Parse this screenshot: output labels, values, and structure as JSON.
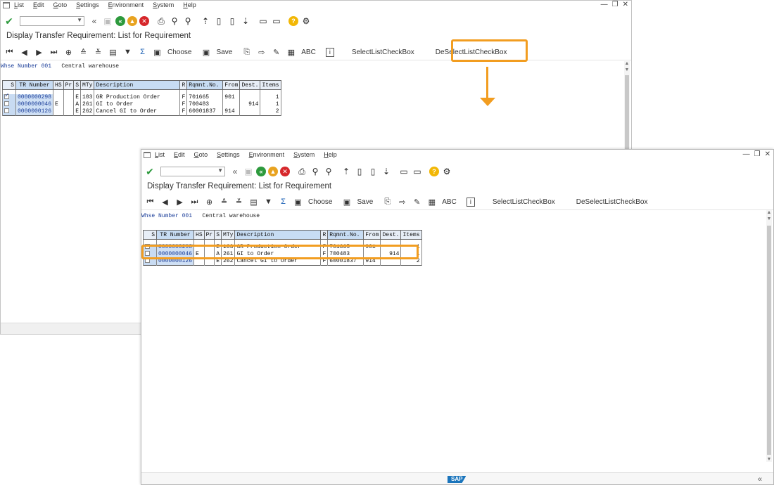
{
  "menu": [
    "List",
    "Edit",
    "Goto",
    "Settings",
    "Environment",
    "System",
    "Help"
  ],
  "window_controls": [
    "—",
    "❐",
    "✕"
  ],
  "screen_title": "Display Transfer Requirement: List for Requirement",
  "toolbar": {
    "choose_label": "Choose",
    "save_label": "Save",
    "abc_label": "ABC",
    "select_label": "SelectListCheckBox",
    "deselect_label": "DeSelectListCheckBox"
  },
  "warehouse": {
    "label": "Whse Number 001",
    "name": "Central warehouse"
  },
  "table": {
    "headers": [
      "S",
      "TR Number",
      "HS",
      "Pr",
      "S",
      "MTy",
      "Description",
      "R",
      "Rqmnt.No.",
      "From",
      "Dest.",
      "Items"
    ],
    "rows": [
      {
        "tr": "0000000298",
        "hs": "",
        "pr": "",
        "s": "E",
        "mty": "103",
        "desc": "GR Production Order",
        "r": "F",
        "rqmnt": "701665",
        "from": "901",
        "dest": "",
        "items": "1"
      },
      {
        "tr": "0000000046",
        "hs": "E",
        "pr": "",
        "s": "A",
        "mty": "261",
        "desc": "GI to Order",
        "r": "F",
        "rqmnt": "700483",
        "from": "",
        "dest": "914",
        "items": "1"
      },
      {
        "tr": "0000000126",
        "hs": "",
        "pr": "",
        "s": "E",
        "mty": "262",
        "desc": "Cancel GI to Order",
        "r": "F",
        "rqmnt": "60001837",
        "from": "914",
        "dest": "",
        "items": "2"
      }
    ]
  },
  "back_checkbox_state": [
    true,
    false,
    false
  ],
  "front_checkbox_state": [
    false,
    false,
    false
  ],
  "sap_logo": "SAP",
  "accent_color": "#f29d20"
}
